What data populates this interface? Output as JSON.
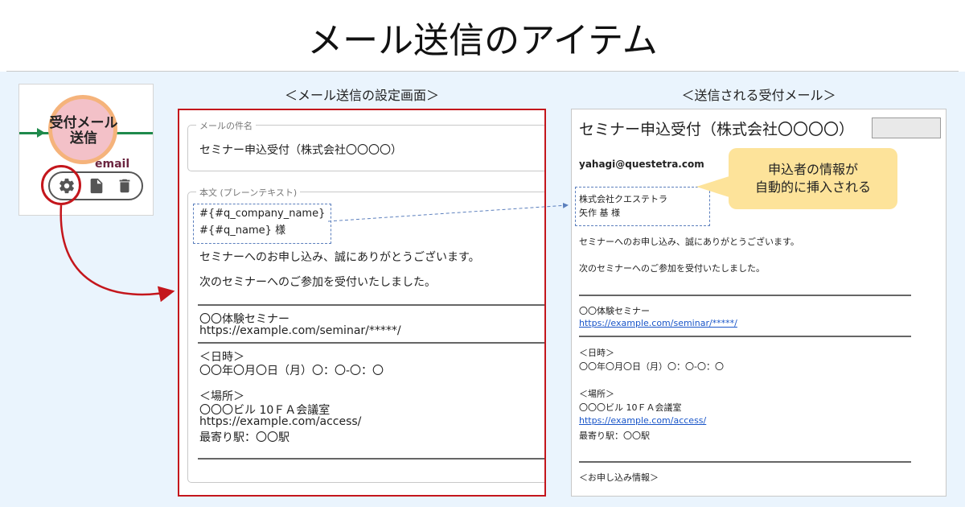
{
  "title": "メール送信のアイテム",
  "labels": {
    "settings_screen": "＜メール送信の設定画面＞",
    "received_email": "＜送信される受付メール＞"
  },
  "workflow_node": {
    "label_line1": "受付メール",
    "label_line2": "送信",
    "sublabel": "email",
    "tools": [
      "gear-icon",
      "document-icon",
      "trash-icon"
    ],
    "colors": {
      "flow_line": "#1f8a4c",
      "node_fill": "#f3c1c8",
      "node_ring": "#f5b37b",
      "highlight": "#c4161c"
    }
  },
  "editor": {
    "subject_legend": "メールの件名",
    "subject_value": "セミナー申込受付（株式会社〇〇〇〇）",
    "body_legend": "本文 (プレーンテキスト)",
    "body_lines": {
      "var_company": "#{#q_company_name}",
      "var_name": "#{#q_name} 様",
      "thanks": "セミナーへのお申し込み、誠にありがとうございます。",
      "accepted": "次のセミナーへのご参加を受付いたしました。",
      "seminar_name": "〇〇体験セミナー",
      "seminar_url": "https://example.com/seminar/*****/",
      "date_heading": "＜日時＞",
      "date_value": "〇〇年〇月〇日（月）〇：〇-〇：〇",
      "place_heading": "＜場所＞",
      "place_value": "〇〇〇ビル 10ＦＡ会議室",
      "access_url": "https://example.com/access/",
      "station": "最寄り駅：〇〇駅"
    }
  },
  "email": {
    "subject": "セミナー申込受付（株式会社〇〇〇〇）",
    "from": "yahagi@questetra.com",
    "company": "株式会社クエステトラ",
    "person": "矢作 基 様",
    "thanks": "セミナーへのお申し込み、誠にありがとうございます。",
    "accepted": "次のセミナーへのご参加を受付いたしました。",
    "seminar_name": "〇〇体験セミナー",
    "seminar_url": "https://example.com/seminar/*****/",
    "date_heading": "＜日時＞",
    "date_value": "〇〇年〇月〇日（月）〇：〇-〇：〇",
    "place_heading": "＜場所＞",
    "place_value": "〇〇〇ビル 10ＦＡ会議室",
    "access_url": "https://example.com/access/",
    "station": "最寄り駅：〇〇駅",
    "info_heading": "＜お申し込み情報＞"
  },
  "callout": {
    "line1": "申込者の情報が",
    "line2": "自動的に挿入される"
  }
}
